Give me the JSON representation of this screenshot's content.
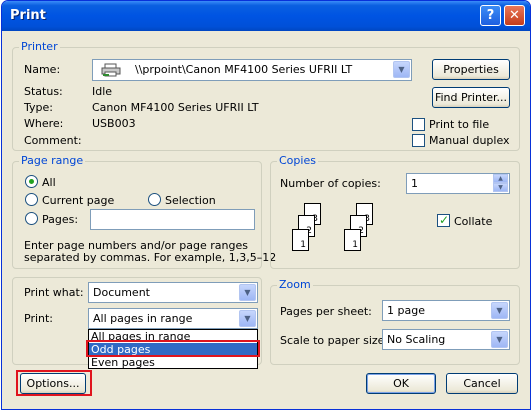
{
  "window": {
    "title": "Print",
    "help_glyph": "?",
    "close_glyph": "✕"
  },
  "printer": {
    "legend": "Printer",
    "name_label": "Name:",
    "name_value": "\\\\prpoint\\Canon MF4100 Series UFRII LT",
    "status_label": "Status:",
    "status_value": "Idle",
    "type_label": "Type:",
    "type_value": "Canon MF4100 Series UFRII LT",
    "where_label": "Where:",
    "where_value": "USB003",
    "comment_label": "Comment:",
    "comment_value": "",
    "properties_button": "Properties",
    "find_printer_button": "Find Printer...",
    "print_to_file_label": "Print to file",
    "print_to_file_checked": false,
    "manual_duplex_label": "Manual duplex",
    "manual_duplex_checked": false
  },
  "page_range": {
    "legend": "Page range",
    "all_label": "All",
    "current_page_label": "Current page",
    "selection_label": "Selection",
    "pages_label": "Pages:",
    "pages_value": "",
    "selected": "All",
    "hint_line1": "Enter page numbers and/or page ranges",
    "hint_line2": "separated by commas.  For example, 1,3,5–12"
  },
  "copies": {
    "legend": "Copies",
    "number_label": "Number of copies:",
    "number_value": "1",
    "collate_label": "Collate",
    "collate_checked": true,
    "stack_numbers": [
      "3",
      "2",
      "1"
    ]
  },
  "print_what": {
    "label": "Print what:",
    "value": "Document"
  },
  "print_select": {
    "label": "Print:",
    "value": "All pages in range",
    "options": [
      "All pages in range",
      "Odd pages",
      "Even pages"
    ],
    "highlighted": "Odd pages"
  },
  "zoom": {
    "legend": "Zoom",
    "pages_per_sheet_label": "Pages per sheet:",
    "pages_per_sheet_value": "1 page",
    "scale_label": "Scale to paper size:",
    "scale_value": "No Scaling"
  },
  "buttons": {
    "options": "Options...",
    "ok": "OK",
    "cancel": "Cancel"
  },
  "colors": {
    "highlight": "#316ac5",
    "annotation_red": "#e0141e",
    "legend_blue": "#0046d5"
  }
}
